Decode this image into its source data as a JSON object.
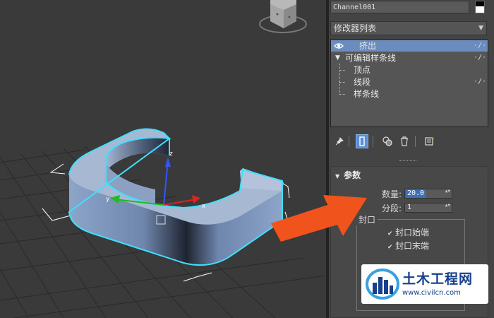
{
  "object_name": "Channel001",
  "modifier_list": {
    "label": "修改器列表",
    "arrow": "▼"
  },
  "stack": {
    "pin_glyph": "·/·",
    "items": [
      {
        "label": "挤出",
        "selected": true
      },
      {
        "label": "可编辑样条线",
        "expand_glyph": "▼"
      },
      {
        "label": "顶点"
      },
      {
        "label": "线段"
      },
      {
        "label": "样条线"
      }
    ]
  },
  "toolbar": {
    "icons": [
      "pin-stack-icon",
      "show-end-result-icon",
      "make-unique-icon",
      "remove-modifier-icon",
      "configure-sets-icon"
    ]
  },
  "params": {
    "title": "参数",
    "title_glyph": "▼",
    "amount_label": "数量:",
    "amount_value": "20.0",
    "segments_label": "分段:",
    "segments_value": "1",
    "spinner_glyph": "▲▼",
    "capping_label": "封口",
    "cap_start_label": "封口始端",
    "cap_start_checked": true,
    "cap_end_label": "封口末端",
    "cap_end_checked": true,
    "check_glyph": "✔"
  },
  "watermark": {
    "title": "土木工程网",
    "url": "www.civilcn.com"
  },
  "colors": {
    "viewport_bg": "#3a3a3a",
    "panel_bg": "#444444",
    "selection": "#6a8cbf",
    "highlight_arrow": "#f0541c",
    "object_outline": "#3fe0ff",
    "watermark_blue": "#163f8c"
  }
}
